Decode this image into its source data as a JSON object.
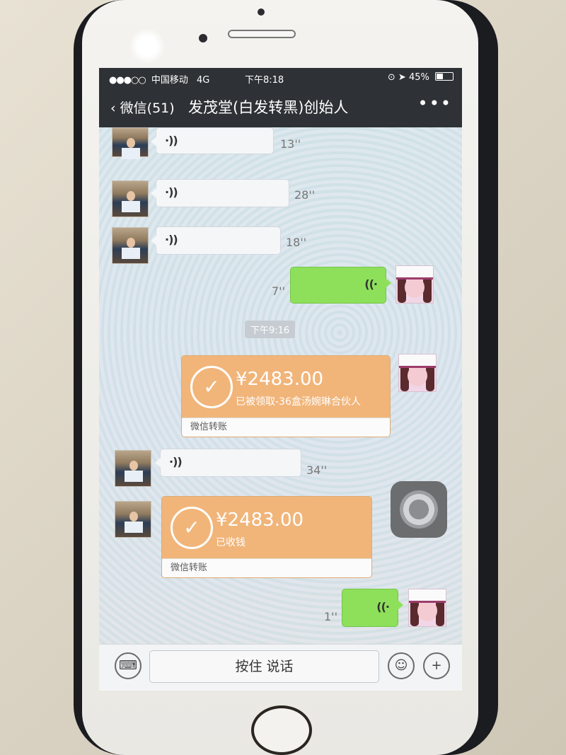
{
  "statusbar": {
    "signal_icon": "signal-dots-icon",
    "carrier": "中国移动",
    "network": "4G",
    "time": "下午8:18",
    "battery": "45%"
  },
  "navbar": {
    "back_label": "微信(51)",
    "title": "发茂堂(白发转黑)创始人",
    "more_icon": "more-icon"
  },
  "messages": {
    "voice": [
      {
        "side": "left",
        "duration": "13''"
      },
      {
        "side": "left",
        "duration": "28''"
      },
      {
        "side": "left",
        "duration": "18''"
      },
      {
        "side": "right",
        "duration": "7''"
      },
      {
        "side": "left",
        "duration": "34''"
      },
      {
        "side": "right",
        "duration": "1''"
      }
    ],
    "time_label": "下午9:16",
    "transfers": [
      {
        "side": "right",
        "amount": "¥2483.00",
        "status": "已被领取-36盒汤婉琳合伙人",
        "footer": "微信转账"
      },
      {
        "side": "left",
        "amount": "¥2483.00",
        "status": "已收钱",
        "footer": "微信转账"
      }
    ]
  },
  "input_bar": {
    "keyboard_icon": "keyboard-icon",
    "talk_label": "按住 说话",
    "emoji_icon": "emoji-icon",
    "plus_icon": "plus-icon"
  },
  "colors": {
    "nav_bg": "#2e3236",
    "voice_green": "#8ee05a",
    "transfer_orange": "#f1b57a"
  }
}
